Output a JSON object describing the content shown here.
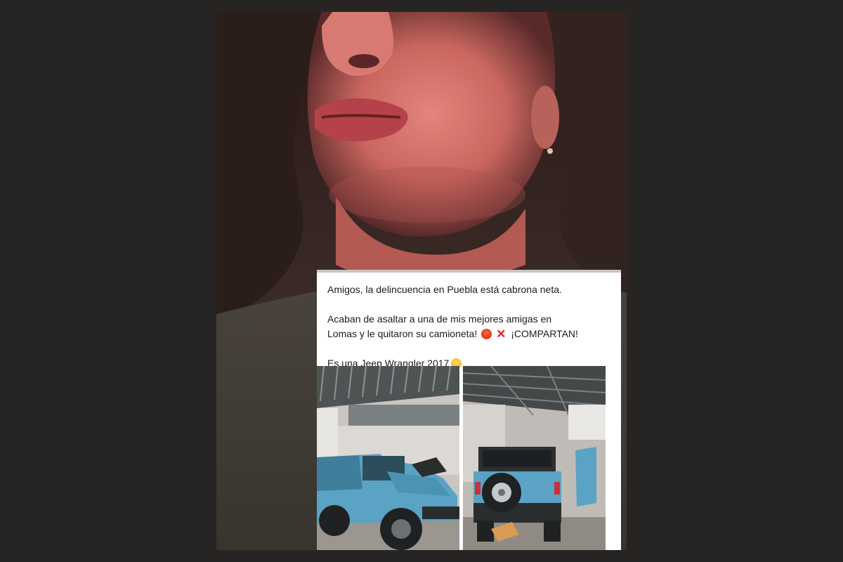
{
  "post": {
    "line1": "Amigos, la delincuencia en Puebla está cabrona neta.",
    "line2a": "Acaban de asaltar a una de mis mejores amigas en",
    "line2b": "Lomas y le quitaron su camioneta!",
    "line2c": "¡COMPARTAN!",
    "line3": "Es una Jeep Wrangler 2017",
    "emojis": [
      "angry-face-icon",
      "cross-mark-icon",
      "pensive-face-icon"
    ]
  },
  "photos": [
    {
      "name": "jeep-front-side-photo",
      "subject": "blue Jeep Wrangler in garage, front three-quarter view"
    },
    {
      "name": "jeep-rear-photo",
      "subject": "blue Jeep Wrangler in garage, rear view with spare tire"
    }
  ],
  "colors": {
    "page_background": "#272524",
    "jeep_blue": "#5aa3c4",
    "post_background": "#ffffff",
    "post_text": "#1b1b1b"
  }
}
